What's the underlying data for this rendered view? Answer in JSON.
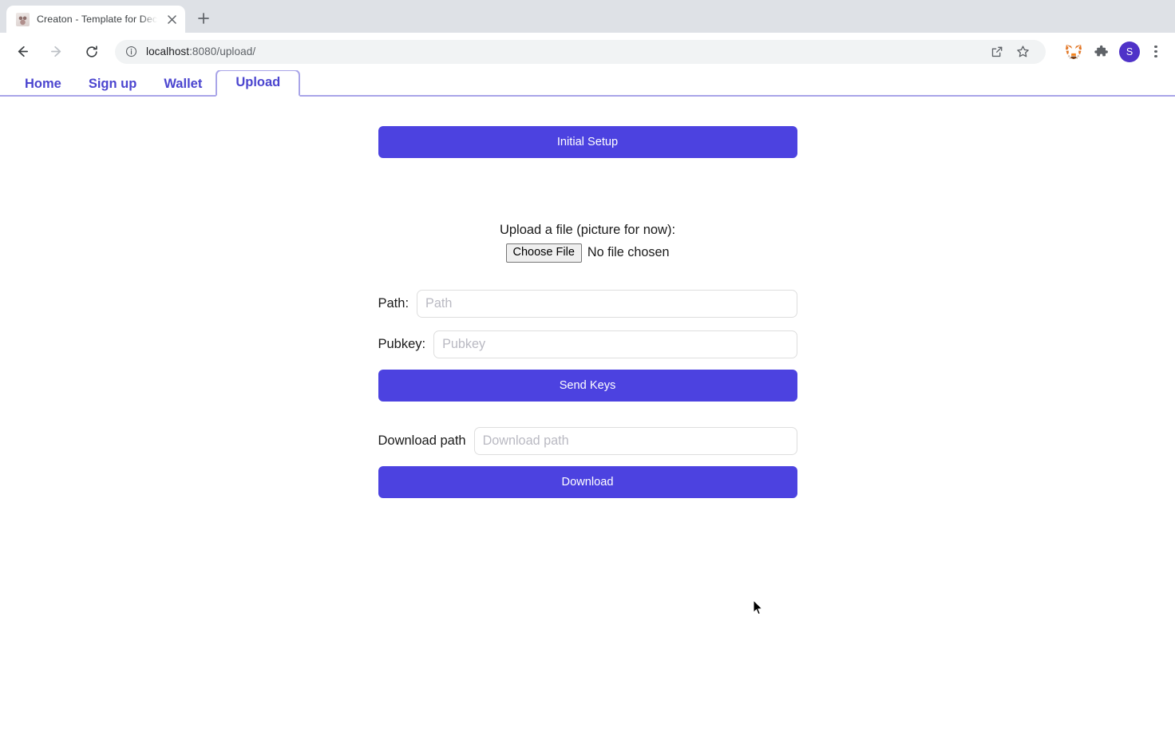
{
  "browser": {
    "tab": {
      "title": "Creaton - Template for Decentr",
      "favicon_name": "creaton-favicon",
      "close_label": "×"
    },
    "new_tab_label": "+",
    "back_label": "←",
    "forward_label": "→",
    "reload_label": "⟳",
    "omnibox": {
      "host": "localhost",
      "path": ":8080/upload/",
      "full_url": "localhost:8080/upload/",
      "info_icon": "site-info-icon"
    },
    "actions": {
      "share_icon": "share-icon",
      "bookmark_icon": "star-icon",
      "metamask_icon": "metamask-fox-icon",
      "extensions_icon": "puzzle-piece-icon",
      "profile_initial": "S",
      "menu_icon": "three-dot-menu-icon"
    }
  },
  "site_nav": {
    "items": [
      {
        "label": "Home",
        "active": false
      },
      {
        "label": "Sign up",
        "active": false
      },
      {
        "label": "Wallet",
        "active": false
      },
      {
        "label": "Upload",
        "active": true
      }
    ]
  },
  "main": {
    "initial_setup_button": "Initial Setup",
    "upload": {
      "label": "Upload a file (picture for now):",
      "choose_file_button": "Choose File",
      "file_status": "No file chosen"
    },
    "fields": {
      "path": {
        "label": "Path:",
        "placeholder": "Path",
        "value": ""
      },
      "pubkey": {
        "label": "Pubkey:",
        "placeholder": "Pubkey",
        "value": ""
      },
      "download_path": {
        "label": "Download path",
        "placeholder": "Download path",
        "value": ""
      }
    },
    "send_keys_button": "Send Keys",
    "download_button": "Download"
  },
  "colors": {
    "accent": "#4c42e0",
    "nav_link": "#4b45cf",
    "nav_border": "#a9a5e8",
    "input_border": "#dedede",
    "placeholder": "#b9b9c2"
  }
}
